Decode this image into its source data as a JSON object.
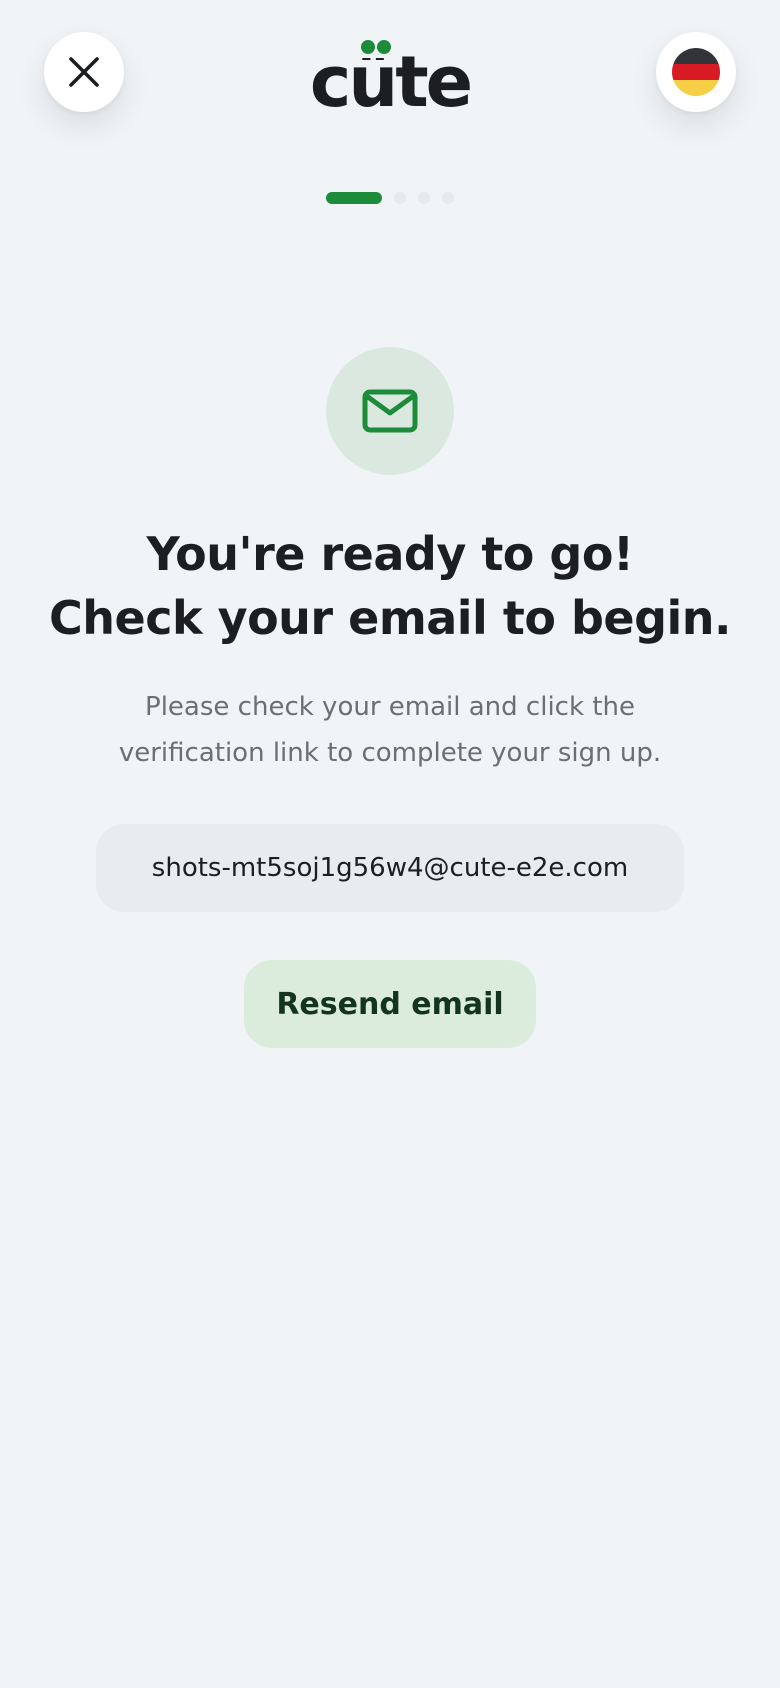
{
  "header": {
    "close_icon": "close-icon",
    "brand": {
      "name": "cüte",
      "accent": "#1c8b3a"
    },
    "language_flag": "germany-flag-icon"
  },
  "progress": {
    "current_step": 1,
    "total_steps": 4
  },
  "main": {
    "icon": "mail-icon",
    "headline_line1": "You're ready to go!",
    "headline_line2": "Check your email to begin.",
    "subtitle_line1": "Please check your email and click the",
    "subtitle_line2": "verification link to complete your sign up.",
    "email": "shots-mt5soj1g56w4@cute-e2e.com",
    "resend_label": "Resend email"
  },
  "colors": {
    "background": "#f1f4f7",
    "accent_green": "#1c8b3a",
    "icon_circle": "#dbe8df",
    "email_box": "#e8ecef",
    "resend_bg": "#dbebdc",
    "resend_text": "#14351d"
  }
}
